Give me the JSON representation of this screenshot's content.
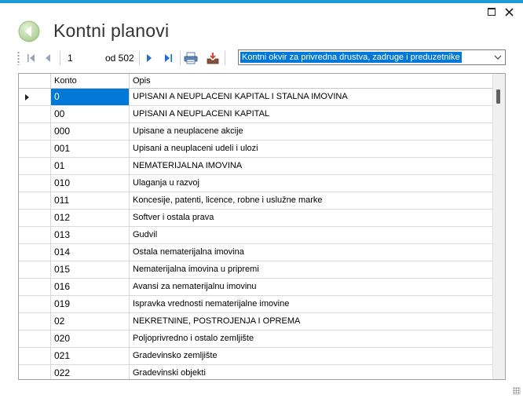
{
  "window": {
    "title": "Kontni planovi",
    "accent": "#1e9bd7"
  },
  "navigator": {
    "position": "1",
    "count_label": "od 502",
    "selected_plan": "Kontni okvir za privredna drustva, zadruge i preduzetnike"
  },
  "grid": {
    "columns": [
      "Konto",
      "Opis"
    ],
    "rows": [
      {
        "konto": "0",
        "opis": "UPISANI A NEUPLACENI KAPITAL I STALNA IMOVINA"
      },
      {
        "konto": "00",
        "opis": "UPISANI A NEUPLACENI KAPITAL"
      },
      {
        "konto": "000",
        "opis": "Upisane a neuplacene akcije"
      },
      {
        "konto": "001",
        "opis": "Upisani a neuplaceni udeli i ulozi"
      },
      {
        "konto": "01",
        "opis": "NEMATERIJALNA IMOVINA"
      },
      {
        "konto": "010",
        "opis": "Ulaganja u razvoj"
      },
      {
        "konto": "011",
        "opis": "Koncesije, patenti, licence, robne i uslužne marke"
      },
      {
        "konto": "012",
        "opis": "Softver i ostala prava"
      },
      {
        "konto": "013",
        "opis": "Gudvil"
      },
      {
        "konto": "014",
        "opis": "Ostala nematerijalna imovina"
      },
      {
        "konto": "015",
        "opis": "Nematerijalna imovina u pripremi"
      },
      {
        "konto": "016",
        "opis": "Avansi za nematerijalnu imovinu"
      },
      {
        "konto": "019",
        "opis": "Ispravka vrednosti nematerijalne imovine"
      },
      {
        "konto": "02",
        "opis": "NEKRETNINE, POSTROJENJA I OPREMA"
      },
      {
        "konto": "020",
        "opis": "Poljoprivredno i ostalo zemljište"
      },
      {
        "konto": "021",
        "opis": "Gradevinsko zemljište"
      },
      {
        "konto": "022",
        "opis": "Gradevinski objekti"
      }
    ],
    "selected_row": 0
  },
  "icons": {
    "back": "back-arrow-icon",
    "first": "first-record-icon",
    "prev": "previous-record-icon",
    "next": "next-record-icon",
    "last": "last-record-icon",
    "print": "printer-icon",
    "export": "export-tray-icon"
  }
}
